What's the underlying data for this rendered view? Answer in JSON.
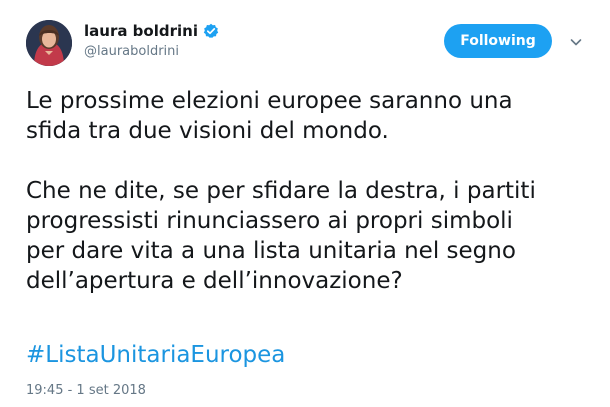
{
  "author": {
    "name": "laura boldrini",
    "handle": "@lauraboldrini",
    "verified_icon": "verified-badge-icon"
  },
  "actions": {
    "follow_label": "Following",
    "more_icon": "chevron-down-icon"
  },
  "tweet": {
    "line1": "Le prossime elezioni europee saranno una",
    "line2": "sfida tra due visioni del mondo.",
    "line3": "Che ne dite, se per sfidare la destra, i partiti",
    "line4": "progressisti rinunciassero ai propri simboli",
    "line5": "per dare vita a una lista unitaria nel segno",
    "line6": "dell’apertura e dell’innovazione?",
    "hashtag": "#ListaUnitariaEuropea",
    "timestamp": "19:45 - 1 set 2018"
  },
  "colors": {
    "accent": "#1da1f2",
    "link": "#1b95e0",
    "text": "#14171a",
    "secondary": "#657786"
  }
}
